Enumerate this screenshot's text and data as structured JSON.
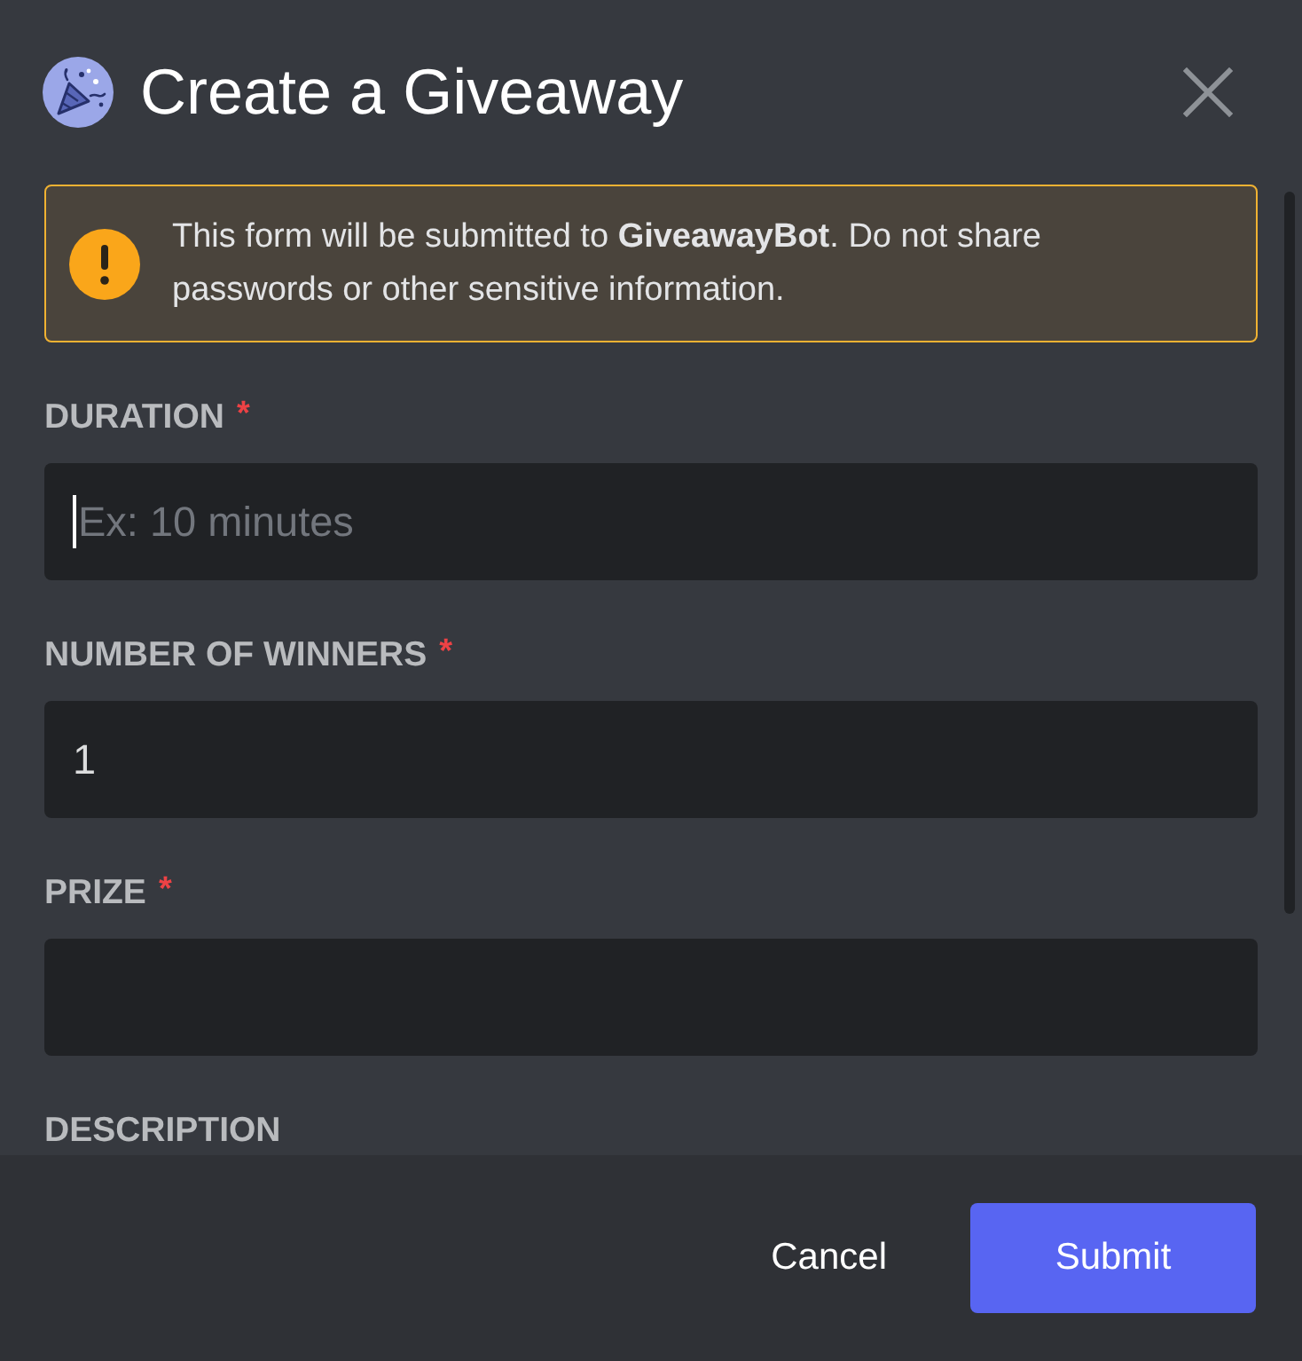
{
  "dialog": {
    "title": "Create a Giveaway"
  },
  "notice": {
    "text": "This form will be submitted to **GiveawayBot**. Do not share passwords or other sensitive information."
  },
  "fields": [
    {
      "label": "DURATION",
      "required_mark": "*",
      "input": {
        "placeholder": "Ex: 10 minutes",
        "focused": true
      }
    },
    {
      "label": "NUMBER OF WINNERS",
      "required_mark": "*",
      "input": {
        "value": "1",
        "focused": false
      }
    },
    {
      "label": "PRIZE",
      "required_mark": "*",
      "input": {
        "focused": false
      }
    },
    {
      "label": "DESCRIPTION"
    }
  ],
  "buttons": [
    {
      "label": "Cancel",
      "kind": "link"
    },
    {
      "label": "Submit",
      "kind": "primary"
    }
  ]
}
